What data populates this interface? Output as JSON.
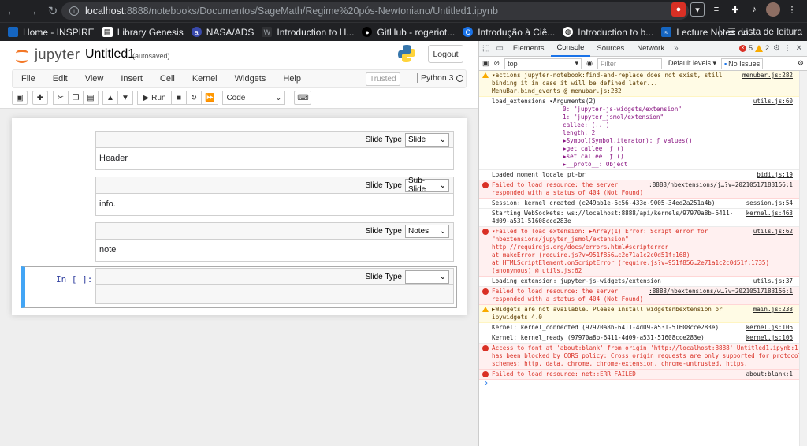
{
  "browser": {
    "url_host": "localhost",
    "url_path": ":8888/notebooks/Documentos/SageMath/Regime%20pós-Newtoniano/Untitled1.ipynb",
    "bookmarks": [
      "Home - INSPIRE",
      "Library Genesis",
      "NASA/ADS",
      "Introduction to H...",
      "GitHub - rogeriot...",
      "Introdução à Ciê...",
      "Introduction to b...",
      "Lecture Notes on..."
    ],
    "reading_list": "Lista de leitura"
  },
  "jupyter": {
    "logo_text": "jupyter",
    "title": "Untitled1",
    "autosaved": "(autosaved)",
    "logout": "Logout",
    "menu": [
      "File",
      "Edit",
      "View",
      "Insert",
      "Cell",
      "Kernel",
      "Widgets",
      "Help"
    ],
    "trusted": "Trusted",
    "kernel": "Python 3",
    "run_label": "Run",
    "cell_type": "Code",
    "slide_type_label": "Slide Type",
    "cells": [
      {
        "slide": "Slide",
        "text": "Header"
      },
      {
        "slide": "Sub-Slide",
        "text": "info."
      },
      {
        "slide": "Notes",
        "text": "note"
      },
      {
        "slide": "",
        "text": ""
      }
    ],
    "prompt": "In [ ]:"
  },
  "devtools": {
    "tabs": [
      "Elements",
      "Console",
      "Sources",
      "Network"
    ],
    "err_count": "5",
    "warn_count": "2",
    "context": "top",
    "filter_placeholder": "Filter",
    "levels": "Default levels ▾",
    "no_issues": "No Issues",
    "messages": [
      {
        "type": "warn",
        "lines": [
          "▾actions jupyter-notebook:find-and-replace does not exist, still",
          "binding it in case it will be defined later...",
          "MenuBar.bind_events @ menubar.js:282"
        ],
        "src": "menubar.js:282"
      },
      {
        "type": "info",
        "lines": [
          "load_extensions ▾Arguments(2)"
        ],
        "sub": [
          "0: \"jupyter-js-widgets/extension\"",
          "1: \"jupyter_jsmol/extension\"",
          "callee: (...)",
          "length: 2",
          "▶Symbol(Symbol.iterator): ƒ values()",
          "▶get callee: ƒ ()",
          "▶set callee: ƒ ()",
          "▶__proto__: Object"
        ],
        "src": "utils.js:60"
      },
      {
        "type": "info",
        "lines": [
          "Loaded moment locale pt-br"
        ],
        "src": "bidi.js:19"
      },
      {
        "type": "err",
        "lines": [
          "Failed to load resource: the server",
          "responded with a status of 404 (Not Found)"
        ],
        "src": ":8888/nbextensions/j…?v=20210517183156:1"
      },
      {
        "type": "info",
        "lines": [
          "Session: kernel_created (c249ab1e-6c56-433e-9005-34ed2a251a4b)"
        ],
        "src": "session.js:54"
      },
      {
        "type": "info",
        "lines": [
          "Starting WebSockets: ws://localhost:8888/api/kernels/97970a8b-6411-",
          "4d09-a531-51608cce283e"
        ],
        "src": "kernel.js:463"
      },
      {
        "type": "err",
        "lines": [
          "▾Failed to load extension: ▶Array(1) Error: Script error for",
          "\"nbextensions/jupyter_jsmol/extension\"",
          "http://requirejs.org/docs/errors.html#scripterror",
          "    at makeError (require.js?v=951f856…c2e71a1c2c0d51f:168)",
          "    at HTMLScriptElement.onScriptError (require.js?v=951f856…2e71a1c2c0d51f:1735)",
          "(anonymous) @ utils.js:62"
        ],
        "src": "utils.js:62"
      },
      {
        "type": "info",
        "lines": [
          "Loading extension: jupyter-js-widgets/extension"
        ],
        "src": "utils.js:37"
      },
      {
        "type": "err",
        "lines": [
          "Failed to load resource: the server",
          "responded with a status of 404 (Not Found)"
        ],
        "src": ":8888/nbextensions/w…?v=20210517183156:1"
      },
      {
        "type": "warn",
        "lines": [
          "▶Widgets are not available.  Please install widgetsnbextension or",
          "ipywidgets 4.0"
        ],
        "src": "main.js:238"
      },
      {
        "type": "info",
        "lines": [
          "Kernel: kernel_connected (97970a8b-6411-4d09-a531-51608cce283e)"
        ],
        "src": "kernel.js:106"
      },
      {
        "type": "info",
        "lines": [
          "Kernel: kernel_ready (97970a8b-6411-4d09-a531-51608cce283e)"
        ],
        "src": "kernel.js:106"
      },
      {
        "type": "err",
        "lines": [
          "Access to font at 'about:blank' from origin 'http://localhost:8888'  Untitled1.ipynb:1",
          "has been blocked by CORS policy: Cross origin requests are only supported for protocol",
          "schemes: http, data, chrome, chrome-extension, chrome-untrusted, https."
        ],
        "src": ""
      },
      {
        "type": "err",
        "lines": [
          "Failed to load resource: net::ERR_FAILED"
        ],
        "src": "about:blank:1"
      }
    ],
    "prompt": "›"
  }
}
